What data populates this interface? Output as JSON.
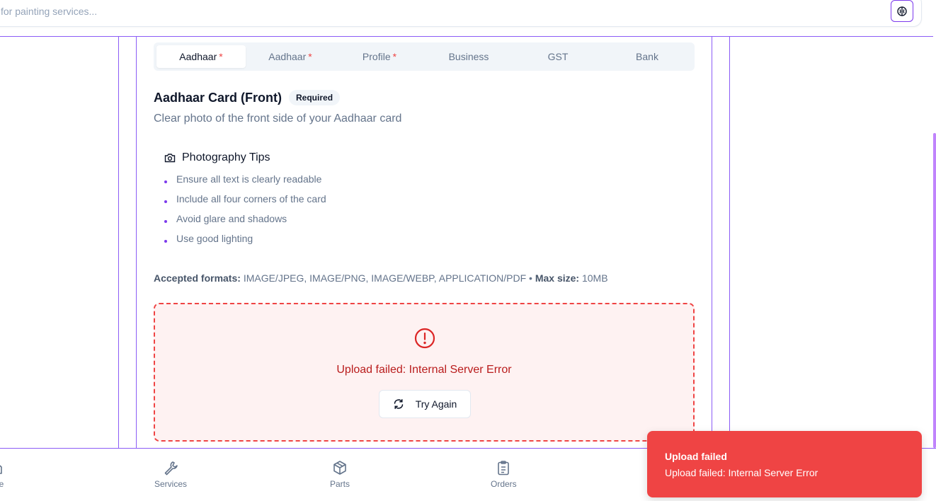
{
  "search": {
    "placeholder": "for painting services..."
  },
  "tabs": [
    {
      "label": "Aadhaar",
      "required": true,
      "active": true
    },
    {
      "label": "Aadhaar",
      "required": true,
      "active": false
    },
    {
      "label": "Profile",
      "required": true,
      "active": false
    },
    {
      "label": "Business",
      "required": false,
      "active": false
    },
    {
      "label": "GST",
      "required": false,
      "active": false
    },
    {
      "label": "Bank",
      "required": false,
      "active": false
    }
  ],
  "required_marker": "*",
  "document": {
    "title": "Aadhaar Card (Front)",
    "badge": "Required",
    "description": "Clear photo of the front side of your Aadhaar card"
  },
  "tips": {
    "title": "Photography Tips",
    "items": [
      "Ensure all text is clearly readable",
      "Include all four corners of the card",
      "Avoid glare and shadows",
      "Use good lighting"
    ]
  },
  "formats": {
    "accepted_label": "Accepted formats:",
    "accepted_value": "IMAGE/JPEG, IMAGE/PNG, IMAGE/WEBP, APPLICATION/PDF",
    "separator": "•",
    "max_label": "Max size:",
    "max_value": "10MB"
  },
  "upload": {
    "error_message": "Upload failed: Internal Server Error",
    "retry_label": "Try Again"
  },
  "bottom_nav": {
    "home": "ome",
    "services": "Services",
    "parts": "Parts",
    "orders": "Orders"
  },
  "toast": {
    "title": "Upload failed",
    "message": "Upload failed: Internal Server Error"
  },
  "colors": {
    "accent": "#7c3aed",
    "error": "#ef4444",
    "error_text": "#b91c1c",
    "error_bg": "#fef2f2"
  }
}
